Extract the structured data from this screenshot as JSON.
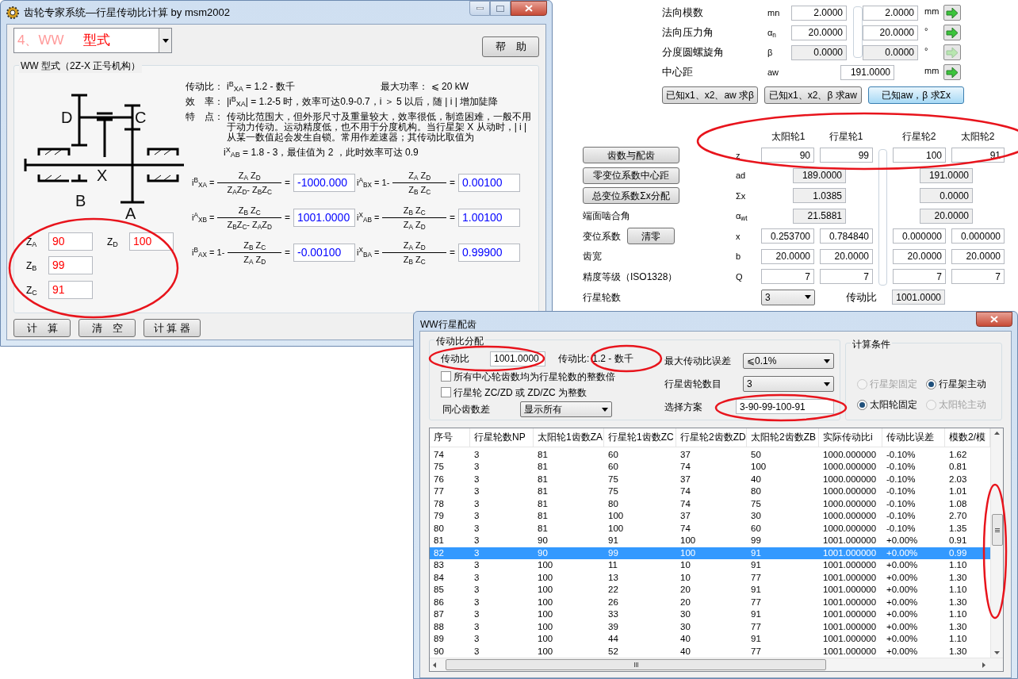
{
  "main_window": {
    "title": "齿轮专家系统—行星传动比计算 by msm2002",
    "type_select": {
      "number": "4、WW",
      "text": "型式"
    },
    "help_button": "帮　助",
    "group_title": "WW 型式（2Z-X 正号机构）",
    "diagram_labels": [
      "D",
      "C",
      "X",
      "B",
      "A"
    ],
    "info": [
      {
        "label": "传动比：",
        "text": "i$^{B}$$_{XA}$ = 1.2 - 数千",
        "note": "最大功率：  ⩽ 20 kW"
      },
      {
        "label": "效　率：",
        "text": "|i$^{B}$$_{XA}$| = 1.2-5 时，效率可达0.9-0.7，i ＞ 5 以后，随 | i | 增加陡降"
      },
      {
        "label": "特　点：",
        "text": "传动比范围大，但外形尺寸及重量较大，效率很低，制造困难，一般不用于动力传动。运动精度低，也不用于分度机构。当行星架 X 从动时，| i | 从某一数值起会发生自锁。常用作差速器；其传动比取值为"
      },
      {
        "text": "i$^{X}$$_{AB}$ = 1.8 - 3，最佳值为 2 ，此时效率可达 0.9"
      }
    ],
    "formulas": [
      {
        "lhs": "i$^{B}$$_{XA}$ =",
        "numerator": "Z$_{A}$ Z$_{D}$",
        "denominator": "Z$_{A}$Z$_{D}$- Z$_{B}$Z$_{C}$",
        "after": "=",
        "value": "-1000.000"
      },
      {
        "lhs": "i$^{A}$$_{BX}$ = 1-",
        "numerator": "Z$_{A}$ Z$_{D}$",
        "denominator": "Z$_{B}$ Z$_{C}$",
        "after": "=",
        "value": "0.00100"
      },
      {
        "lhs": "i$^{A}$$_{XB}$ =",
        "numerator": "Z$_{B}$ Z$_{C}$",
        "denominator": "Z$_{B}$Z$_{C}$- Z$_{A}$Z$_{D}$",
        "after": "=",
        "value": "1001.0000"
      },
      {
        "lhs": "i$^{X}$$_{AB}$ =",
        "numerator": "Z$_{B}$ Z$_{C}$",
        "denominator": "Z$_{A}$ Z$_{D}$",
        "after": "=",
        "value": "1.00100"
      },
      {
        "lhs": "i$^{B}$$_{AX}$ = 1-",
        "numerator": "Z$_{B}$ Z$_{C}$",
        "denominator": "Z$_{A}$ Z$_{D}$",
        "after": "=",
        "value": "-0.00100"
      },
      {
        "lhs": "i$^{X}$$_{BA}$ =",
        "numerator": "Z$_{A}$ Z$_{D}$",
        "denominator": "Z$_{B}$ Z$_{C}$",
        "after": "=",
        "value": "0.99900"
      }
    ],
    "teeth_inputs": [
      {
        "label": "Z$_{A}$",
        "value": "90"
      },
      {
        "label": "Z$_{D}$",
        "value": "100"
      },
      {
        "label": "Z$_{B}$",
        "value": "99"
      },
      {
        "label": "Z$_{C}$",
        "value": "91"
      }
    ],
    "buttons": [
      "计　算",
      "清　空",
      "计 算 器"
    ]
  },
  "gear_params": {
    "rows": [
      {
        "label": "法向模数",
        "symbol": "mn",
        "values": [
          "2.0000",
          "2.0000"
        ],
        "unit": "mm",
        "disabled": false
      },
      {
        "label": "法向压力角",
        "symbol": "α$_{n}$",
        "values": [
          "20.0000",
          "20.0000"
        ],
        "unit": "°",
        "disabled": false
      },
      {
        "label": "分度圆螺旋角",
        "symbol": "β",
        "values": [
          "0.0000",
          "0.0000"
        ],
        "unit": "°",
        "disabled": true
      },
      {
        "label": "中心距",
        "symbol": "aw",
        "values": [
          "191.0000"
        ],
        "unit": "mm",
        "disabled": false
      }
    ],
    "buttons": [
      {
        "label": "已知x1、x2、aw 求β",
        "selected": false
      },
      {
        "label": "已知x1、x2、β 求aw",
        "selected": false
      },
      {
        "label": "已知aw，β 求Σx",
        "selected": true
      }
    ]
  },
  "gear_table": {
    "columns": [
      "太阳轮1",
      "行星轮1",
      "行星轮2",
      "太阳轮2"
    ],
    "rows": [
      {
        "button": "齿数与配齿",
        "symbol": "z",
        "kind": "input",
        "values": [
          "90",
          "99",
          "100",
          "91"
        ]
      },
      {
        "button": "零变位系数中心距",
        "symbol": "ad",
        "kind": "readonly",
        "values": [
          "189.0000",
          "191.0000"
        ]
      },
      {
        "button": "总变位系数Σx分配",
        "symbol": "Σx",
        "kind": "readonly",
        "values": [
          "1.0385",
          "0.0000"
        ]
      },
      {
        "label": "端面啮合角",
        "symbol": "α$_{wt}$",
        "kind": "readonly",
        "values": [
          "21.5881",
          "20.0000"
        ]
      },
      {
        "label": "变位系数",
        "button": "清零",
        "symbol": "x",
        "kind": "input",
        "values": [
          "0.253700",
          "0.784840",
          "0.000000",
          "0.000000"
        ]
      },
      {
        "label": "齿宽",
        "symbol": "b",
        "kind": "input",
        "values": [
          "20.0000",
          "20.0000",
          "20.0000",
          "20.0000"
        ]
      },
      {
        "label": "精度等级（ISO1328）",
        "symbol": "Q",
        "kind": "input",
        "values": [
          "7",
          "7",
          "7",
          "7"
        ]
      }
    ],
    "planets": {
      "label": "行星轮数",
      "value": "3",
      "ratio_label": "传动比",
      "ratio_value": "1001.0000"
    }
  },
  "dialog": {
    "title": "WW行星配齿",
    "ratio_group": {
      "title": "传动比分配",
      "ratio_label": "传动比",
      "ratio_value": "1001.0000",
      "range_label": "传动比:",
      "range_value": "1.2 - 数千",
      "checkboxes": [
        {
          "label": "所有中心轮齿数均为行星轮数的整数倍",
          "checked": false
        },
        {
          "label": "行星轮 ZC/ZD 或 ZD/ZC 为整数",
          "checked": false
        }
      ],
      "tooth_diff": {
        "label": "同心齿数差",
        "value": "显示所有"
      },
      "max_error": {
        "label": "最大传动比误差",
        "value": "⩽0.1%"
      },
      "planet_count": {
        "label": "行星齿轮数目",
        "value": "3"
      },
      "scheme": {
        "label": "选择方案",
        "value": "3-90-99-100-91"
      }
    },
    "conditions": {
      "title": "计算条件",
      "options": [
        {
          "label": "行星架固定",
          "selected": false,
          "disabled": true
        },
        {
          "label": "行星架主动",
          "selected": true,
          "disabled": false
        },
        {
          "label": "太阳轮固定",
          "selected": true,
          "disabled": false
        },
        {
          "label": "太阳轮主动",
          "selected": false,
          "disabled": true
        }
      ]
    },
    "table": {
      "columns": [
        "序号",
        "行星轮数NP",
        "太阳轮1齿数ZA",
        "行星轮1齿数ZC",
        "行星轮2齿数ZD",
        "太阳轮2齿数ZB",
        "实际传动比i",
        "传动比误差",
        "模数2/模"
      ],
      "rows": [
        {
          "cells": [
            "74",
            "3",
            "81",
            "60",
            "37",
            "50",
            "1000.000000",
            "-0.10%",
            "1.62"
          ],
          "selected": false
        },
        {
          "cells": [
            "75",
            "3",
            "81",
            "60",
            "74",
            "100",
            "1000.000000",
            "-0.10%",
            "0.81"
          ],
          "selected": false
        },
        {
          "cells": [
            "76",
            "3",
            "81",
            "75",
            "37",
            "40",
            "1000.000000",
            "-0.10%",
            "2.03"
          ],
          "selected": false
        },
        {
          "cells": [
            "77",
            "3",
            "81",
            "75",
            "74",
            "80",
            "1000.000000",
            "-0.10%",
            "1.01"
          ],
          "selected": false
        },
        {
          "cells": [
            "78",
            "3",
            "81",
            "80",
            "74",
            "75",
            "1000.000000",
            "-0.10%",
            "1.08"
          ],
          "selected": false
        },
        {
          "cells": [
            "79",
            "3",
            "81",
            "100",
            "37",
            "30",
            "1000.000000",
            "-0.10%",
            "2.70"
          ],
          "selected": false
        },
        {
          "cells": [
            "80",
            "3",
            "81",
            "100",
            "74",
            "60",
            "1000.000000",
            "-0.10%",
            "1.35"
          ],
          "selected": false
        },
        {
          "cells": [
            "81",
            "3",
            "90",
            "91",
            "100",
            "99",
            "1001.000000",
            "+0.00%",
            "0.91"
          ],
          "selected": false
        },
        {
          "cells": [
            "82",
            "3",
            "90",
            "99",
            "100",
            "91",
            "1001.000000",
            "+0.00%",
            "0.99"
          ],
          "selected": true
        },
        {
          "cells": [
            "83",
            "3",
            "100",
            "11",
            "10",
            "91",
            "1001.000000",
            "+0.00%",
            "1.10"
          ],
          "selected": false
        },
        {
          "cells": [
            "84",
            "3",
            "100",
            "13",
            "10",
            "77",
            "1001.000000",
            "+0.00%",
            "1.30"
          ],
          "selected": false
        },
        {
          "cells": [
            "85",
            "3",
            "100",
            "22",
            "20",
            "91",
            "1001.000000",
            "+0.00%",
            "1.10"
          ],
          "selected": false
        },
        {
          "cells": [
            "86",
            "3",
            "100",
            "26",
            "20",
            "77",
            "1001.000000",
            "+0.00%",
            "1.30"
          ],
          "selected": false
        },
        {
          "cells": [
            "87",
            "3",
            "100",
            "33",
            "30",
            "91",
            "1001.000000",
            "+0.00%",
            "1.10"
          ],
          "selected": false
        },
        {
          "cells": [
            "88",
            "3",
            "100",
            "39",
            "30",
            "77",
            "1001.000000",
            "+0.00%",
            "1.30"
          ],
          "selected": false
        },
        {
          "cells": [
            "89",
            "3",
            "100",
            "44",
            "40",
            "91",
            "1001.000000",
            "+0.00%",
            "1.10"
          ],
          "selected": false
        },
        {
          "cells": [
            "90",
            "3",
            "100",
            "52",
            "40",
            "77",
            "1001.000000",
            "+0.00%",
            "1.30"
          ],
          "selected": false
        }
      ]
    }
  }
}
